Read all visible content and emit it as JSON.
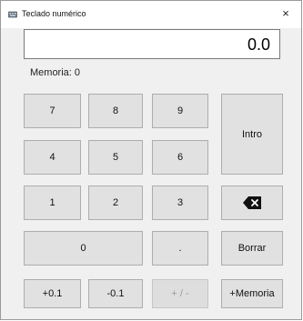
{
  "window": {
    "title": "Teclado numérico",
    "close_label": "×"
  },
  "display": {
    "value": "0.0"
  },
  "memory": {
    "label": "Memoria: 0"
  },
  "keys": {
    "seven": "7",
    "eight": "8",
    "nine": "9",
    "four": "4",
    "five": "5",
    "six": "6",
    "one": "1",
    "two": "2",
    "three": "3",
    "zero": "0",
    "dot": ".",
    "enter": "Intro",
    "clear": "Borrar",
    "plus_tenth": "+0.1",
    "minus_tenth": "-0.1",
    "sign": "+ / -",
    "add_memory": "+Memoria"
  },
  "icons": {
    "backspace": "backspace-icon",
    "app": "keyboard-icon"
  }
}
